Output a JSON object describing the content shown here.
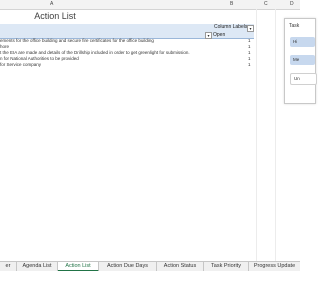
{
  "columns": {
    "a": "A",
    "b": "B",
    "c": "C",
    "d": "D"
  },
  "title": "Action List",
  "pivot": {
    "column_labels": "Column Labels",
    "open": "Open",
    "rows": [
      {
        "text": "ements for the office building and secure fire certificates for the office building",
        "count": "1"
      },
      {
        "text": "hore",
        "count": "1"
      },
      {
        "text": "t the EIA are made and details of the Drillship included in order to get greenlight for submission.",
        "count": "1"
      },
      {
        "text": "n for National Authorities to be provided",
        "count": "1"
      },
      {
        "text": "for Service company",
        "count": "1"
      }
    ]
  },
  "slicer": {
    "title": "Task",
    "items": [
      "Hi",
      "Me",
      "Un"
    ]
  },
  "tabs": [
    "er",
    "Agenda List",
    "Action List",
    "Action Due Days",
    "Action Status",
    "Task Priority",
    "Progress Update"
  ],
  "active_tab": "Action List",
  "colors": {
    "accent": "#217346",
    "pivot_header": "#dde8f5",
    "slicer_selected": "#c7d8ee"
  }
}
